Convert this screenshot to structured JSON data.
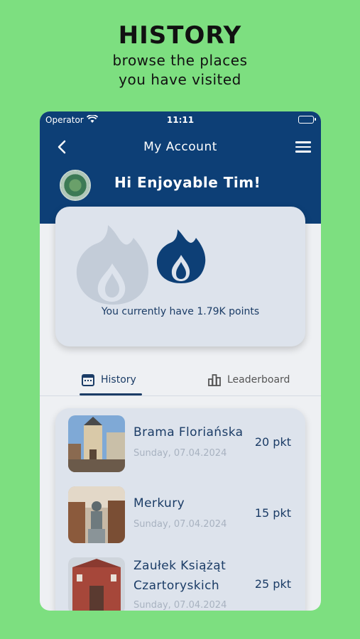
{
  "promo": {
    "title": "HISTORY",
    "subtitle_line1": "browse the places",
    "subtitle_line2": "you have visited"
  },
  "status_bar": {
    "carrier": "Operator",
    "time": "11:11"
  },
  "nav": {
    "title": "My Account"
  },
  "greeting": "Hi Enjoyable Tim!",
  "points": {
    "text": "You currently have 1.79K points"
  },
  "tabs": [
    {
      "label": "History",
      "icon": "calendar-icon",
      "active": true
    },
    {
      "label": "Leaderboard",
      "icon": "bar-chart-icon",
      "active": false
    }
  ],
  "history": [
    {
      "name": "Brama Floriańska",
      "name_line2": "",
      "date": "Sunday, 07.04.2024",
      "points": "20 pkt"
    },
    {
      "name": "Merkury",
      "name_line2": "",
      "date": "Sunday, 07.04.2024",
      "points": "15 pkt"
    },
    {
      "name": "Zaułek Książąt",
      "name_line2": "Czartoryskich",
      "date": "Sunday, 07.04.2024",
      "points": "25 pkt"
    }
  ],
  "colors": {
    "background": "#7ddf80",
    "header": "#0d3f76",
    "accent": "#1b3c66",
    "card": "#dde3ec"
  }
}
